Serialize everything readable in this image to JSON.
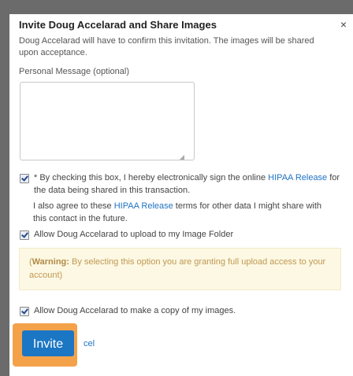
{
  "dialog": {
    "title": "Invite Doug Accelarad and Share Images",
    "close_glyph": "×",
    "description": "Doug Accelarad will have to confirm this invitation. The images will be shared upon acceptance.",
    "message_label": "Personal Message (optional)",
    "message_value": "",
    "hipaa": {
      "checked": true,
      "text_before": "* By checking this box, I hereby electronically sign the online ",
      "link": "HIPAA Release",
      "text_after": " for the data being shared in this transaction."
    },
    "agree": {
      "text_before": "I also agree to these ",
      "link": "HIPAA Release",
      "text_after": " terms for other data I might share with this contact in the future."
    },
    "upload": {
      "checked": true,
      "label": "Allow Doug Accelarad to upload to my Image Folder"
    },
    "warning": {
      "open_paren": "(",
      "bold": "Warning:",
      "text": " By selecting this option you are granting full upload access to your account)"
    },
    "copy": {
      "checked": true,
      "label": "Allow Doug Accelarad to make a copy of my images."
    },
    "buttons": {
      "invite": "Invite",
      "cancel": "cel"
    }
  },
  "colors": {
    "accent": "#1b76c4",
    "highlight": "#f4a24a",
    "link": "#1f73c3",
    "warning_bg": "#fcf8e3"
  }
}
